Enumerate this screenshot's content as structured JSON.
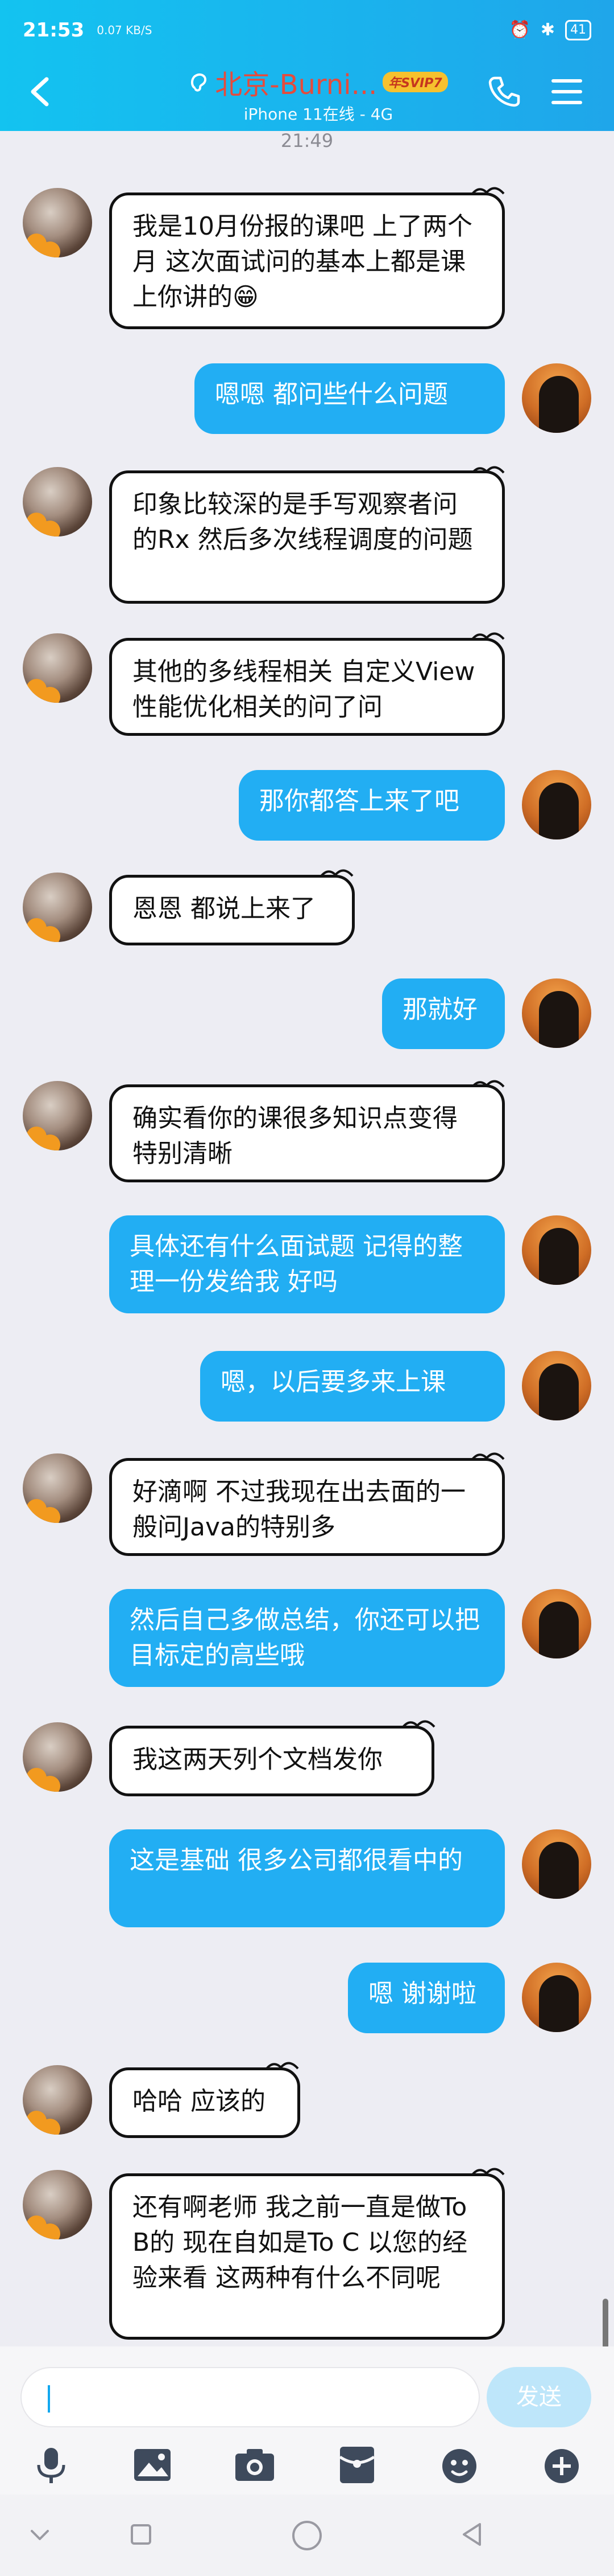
{
  "status_bar": {
    "time": "21:53",
    "net_speed": "0.07 KB/S",
    "battery": "41"
  },
  "header": {
    "title": "北京-Burni...",
    "vip_badge": "年SVIP7",
    "subtitle": "iPhone 11在线 - 4G"
  },
  "chat": {
    "timestamp": "21:49",
    "messages": [
      {
        "side": "left",
        "text": "我是10月份报的课吧 上了两个月 这次面试问的基本上都是课上你讲的😁"
      },
      {
        "side": "right",
        "text": "嗯嗯  都问些什么问题"
      },
      {
        "side": "left",
        "text": "印象比较深的是手写观察者问的Rx  然后多次线程调度的问题"
      },
      {
        "side": "left",
        "text": "其他的多线程相关 自定义View 性能优化相关的问了问"
      },
      {
        "side": "right",
        "text": "那你都答上来了吧"
      },
      {
        "side": "left",
        "text": "恩恩 都说上来了"
      },
      {
        "side": "right",
        "text": "那就好"
      },
      {
        "side": "left",
        "text": "确实看你的课很多知识点变得特别清晰"
      },
      {
        "side": "right",
        "text": "具体还有什么面试题 记得的整理一份发给我 好吗"
      },
      {
        "side": "right",
        "text": "嗯，以后要多来上课"
      },
      {
        "side": "left",
        "text": "好滴啊 不过我现在出去面的一般问Java的特别多"
      },
      {
        "side": "right",
        "text": "然后自己多做总结，你还可以把目标定的高些哦"
      },
      {
        "side": "left",
        "text": "我这两天列个文档发你"
      },
      {
        "side": "right",
        "text": "这是基础 很多公司都很看中的"
      },
      {
        "side": "right",
        "text": "嗯 谢谢啦"
      },
      {
        "side": "left",
        "text": "哈哈 应该的"
      },
      {
        "side": "left",
        "text": "还有啊老师 我之前一直是做To B的 现在自如是To C  以您的经验来看 这两种有什么不同呢"
      }
    ]
  },
  "input": {
    "value": "",
    "send_label": "发送"
  },
  "toolbar": {
    "icons": [
      "microphone-icon",
      "image-icon",
      "camera-icon",
      "red-packet-icon",
      "emoji-icon",
      "plus-icon"
    ]
  },
  "colors": {
    "header_start": "#13C3F0",
    "header_end": "#1FA6EA",
    "bubble_right": "#22AEF3",
    "title_red": "#E64B3C"
  }
}
